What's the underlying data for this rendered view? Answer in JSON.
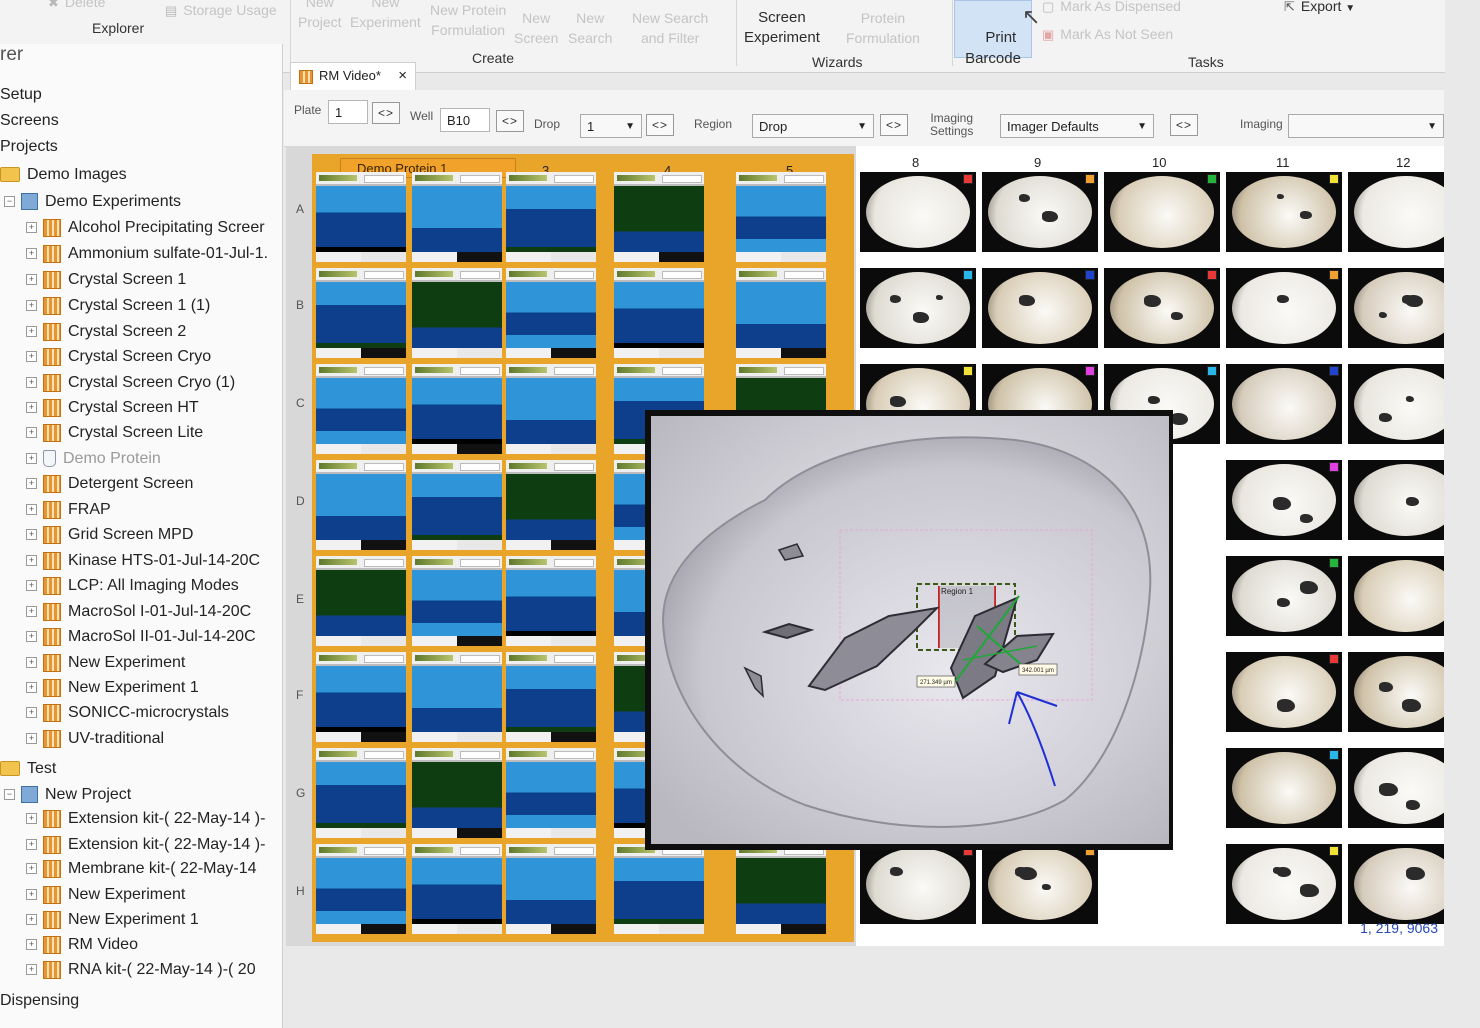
{
  "ribbon": {
    "items": {
      "delete": "Delete",
      "storage_usage": "Storage Usage",
      "new_project": "New\nProject",
      "new_experiment": "New\nExperiment",
      "new_protein_formulation": "New Protein\nFormulation",
      "new_screen": "New\nScreen",
      "new_search": "New\nSearch",
      "new_search_filter": "New Search\nand Filter",
      "screen_experiment": "Screen\nExperiment",
      "protein_formulation": "Protein\nFormulation",
      "print_barcode": "Print\nBarcode",
      "mark_dispensed": "Mark As Dispensed",
      "mark_not_seen": "Mark As Not Seen",
      "export": "Export"
    },
    "groups": {
      "explorer": "Explorer",
      "create": "Create",
      "wizards": "Wizards",
      "tasks": "Tasks"
    }
  },
  "explorer": {
    "title": "rer",
    "nodes": [
      "Setup",
      "Screens",
      "Projects",
      "Demo Images",
      "Demo Experiments",
      "Alcohol Precipitating Screer",
      "Ammonium sulfate-01-Jul-1.",
      "Crystal Screen 1",
      "Crystal Screen 1 (1)",
      "Crystal Screen 2",
      "Crystal Screen Cryo",
      "Crystal Screen Cryo (1)",
      "Crystal Screen HT",
      "Crystal Screen Lite",
      "Demo Protein",
      "Detergent Screen",
      "FRAP",
      "Grid Screen MPD",
      "Kinase HTS-01-Jul-14-20C",
      "LCP: All Imaging Modes",
      "MacroSol I-01-Jul-14-20C",
      "MacroSol II-01-Jul-14-20C",
      "New Experiment",
      "New Experiment 1",
      "SONICC-microcrystals",
      "UV-traditional",
      "Test",
      "New Project",
      "Extension kit-( 22-May-14 )-",
      "Extension kit-( 22-May-14 )-",
      "Membrane kit-( 22-May-14",
      "New Experiment",
      "New Experiment 1",
      "RM Video",
      "RNA kit-( 22-May-14 )-( 20",
      "Dispensing"
    ]
  },
  "tab": {
    "label": "RM Video*",
    "close": "×"
  },
  "toolbar": {
    "plate_label": "Plate",
    "plate_value": "1",
    "well_label": "Well",
    "well_value": "B10",
    "drop_label": "Drop",
    "drop_value": "1",
    "region_label": "Region",
    "region_value": "Drop",
    "imaging_settings_label": "Imaging\nSettings",
    "imaging_settings_value": "Imager Defaults",
    "imaging_label": "Imaging",
    "imaging_value": "",
    "nav": "<>"
  },
  "plate": {
    "tag": "Demo Protein 1",
    "col_labels_left": [
      "3",
      "4",
      "5"
    ],
    "col_labels_right": [
      "8",
      "9",
      "10",
      "11",
      "12"
    ],
    "row_labels": [
      "A",
      "B",
      "C",
      "D",
      "E",
      "F",
      "G",
      "H"
    ],
    "footer": "1, 219, 9063"
  },
  "zoom": {
    "region_label": "Region 1",
    "measure_1": "271.349 µm",
    "measure_2": "342.001 µm"
  },
  "colors": {
    "accent_orange": "#e8a52a",
    "well_blue_light": "#2f95d8",
    "well_blue_dark": "#0d3f8c",
    "well_green": "#0f3d12",
    "annotation_blue": "#1f2fd6",
    "annotation_green": "#1fa83a",
    "annotation_red": "#d01d1d"
  }
}
